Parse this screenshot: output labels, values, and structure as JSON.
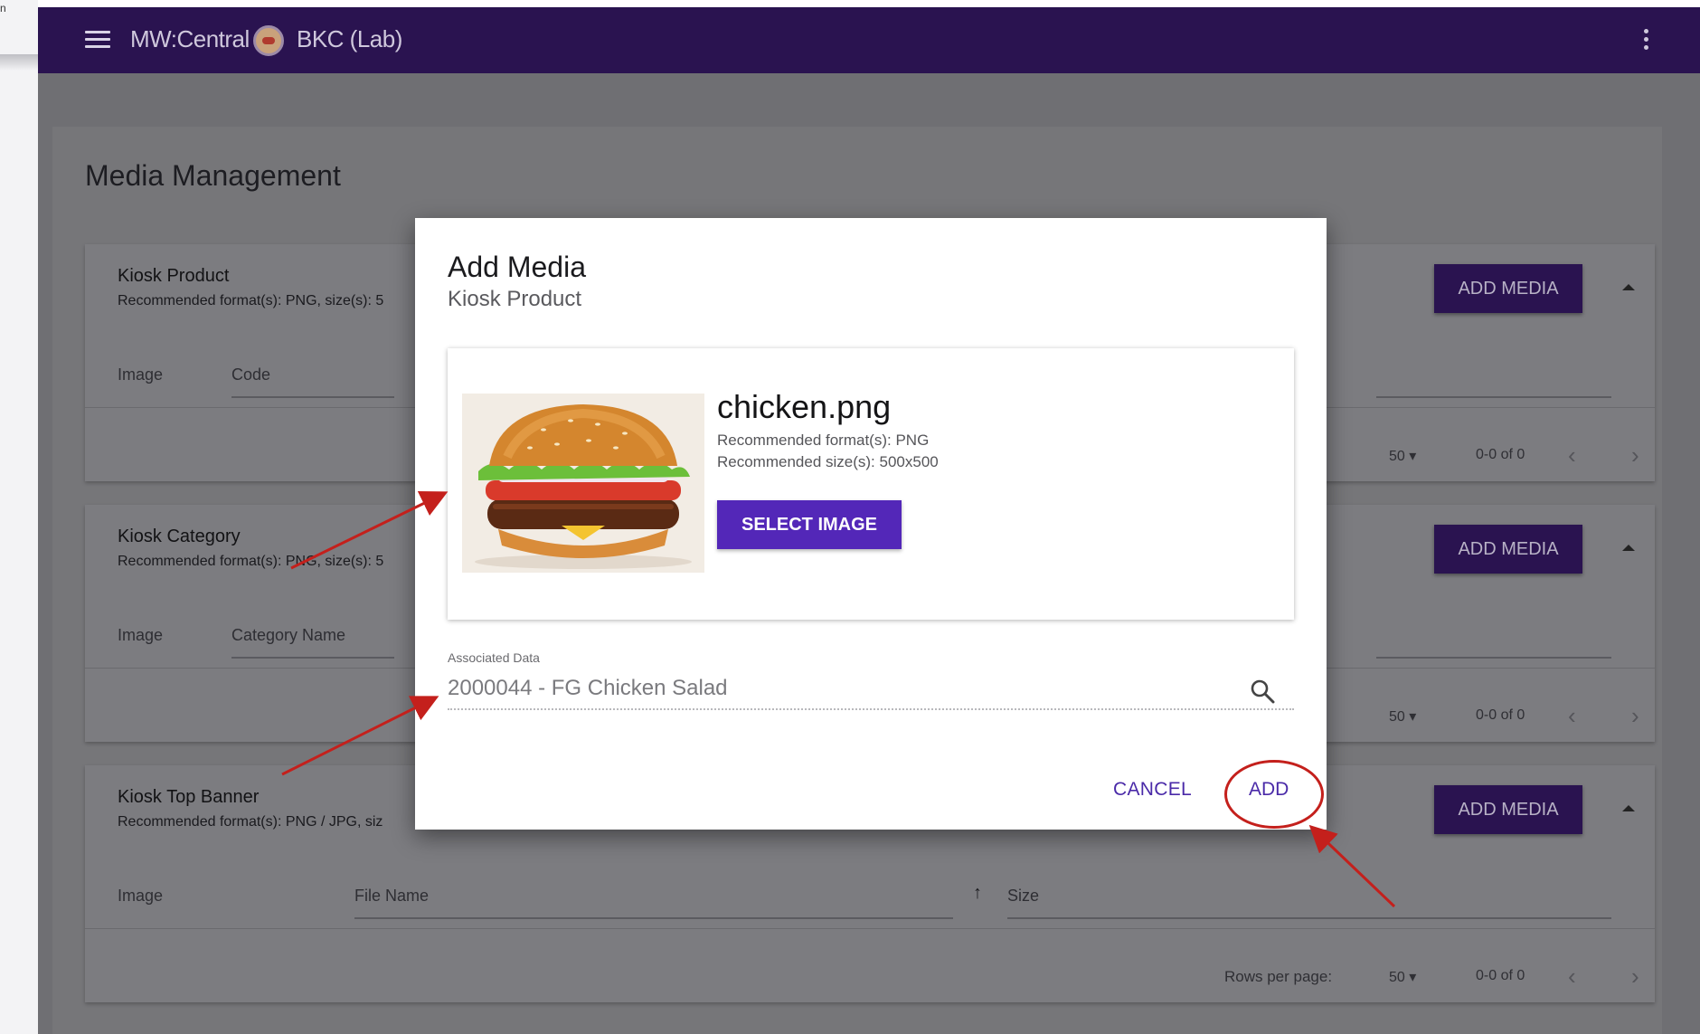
{
  "left_strip": {
    "fragment": "n"
  },
  "topbar": {
    "app_name": "MW:Central",
    "store_name": "BKC (Lab)"
  },
  "page": {
    "title": "Media Management"
  },
  "sections": [
    {
      "title": "Kiosk Product",
      "subtitle": "Recommended format(s): PNG, size(s): 5",
      "add_media_label": "ADD MEDIA",
      "columns": [
        "Image",
        "Code"
      ],
      "rows_per_page": "50",
      "range": "0-0 of 0"
    },
    {
      "title": "Kiosk Category",
      "subtitle": "Recommended format(s): PNG, size(s): 5",
      "add_media_label": "ADD MEDIA",
      "columns": [
        "Image",
        "Category Name"
      ],
      "rows_per_page": "50",
      "range": "0-0 of 0"
    },
    {
      "title": "Kiosk Top Banner",
      "subtitle": "Recommended format(s): PNG / JPG, siz",
      "add_media_label": "ADD MEDIA",
      "columns": [
        "Image",
        "File Name",
        "Size"
      ],
      "rows_per_page_label": "Rows per page:",
      "rows_per_page": "50",
      "range": "0-0 of 0"
    }
  ],
  "modal": {
    "title": "Add Media",
    "subtitle": "Kiosk Product",
    "file_name": "chicken.png",
    "recommended_format": "Recommended format(s): PNG",
    "recommended_size": "Recommended size(s): 500x500",
    "select_image_label": "SELECT IMAGE",
    "associated_label": "Associated Data",
    "associated_value": "2000044 - FG Chicken Salad",
    "cancel_label": "CANCEL",
    "add_label": "ADD"
  },
  "colors": {
    "topbar": "#2a1350",
    "primary_button": "#5327b8",
    "annotation_red": "#c4201c"
  },
  "icons": [
    "menu-icon",
    "brand-logo-icon",
    "more-vert-icon",
    "search-icon",
    "chevron-left-icon",
    "chevron-right-icon",
    "arrow-up-icon",
    "caret-up-icon",
    "caret-down-icon"
  ]
}
